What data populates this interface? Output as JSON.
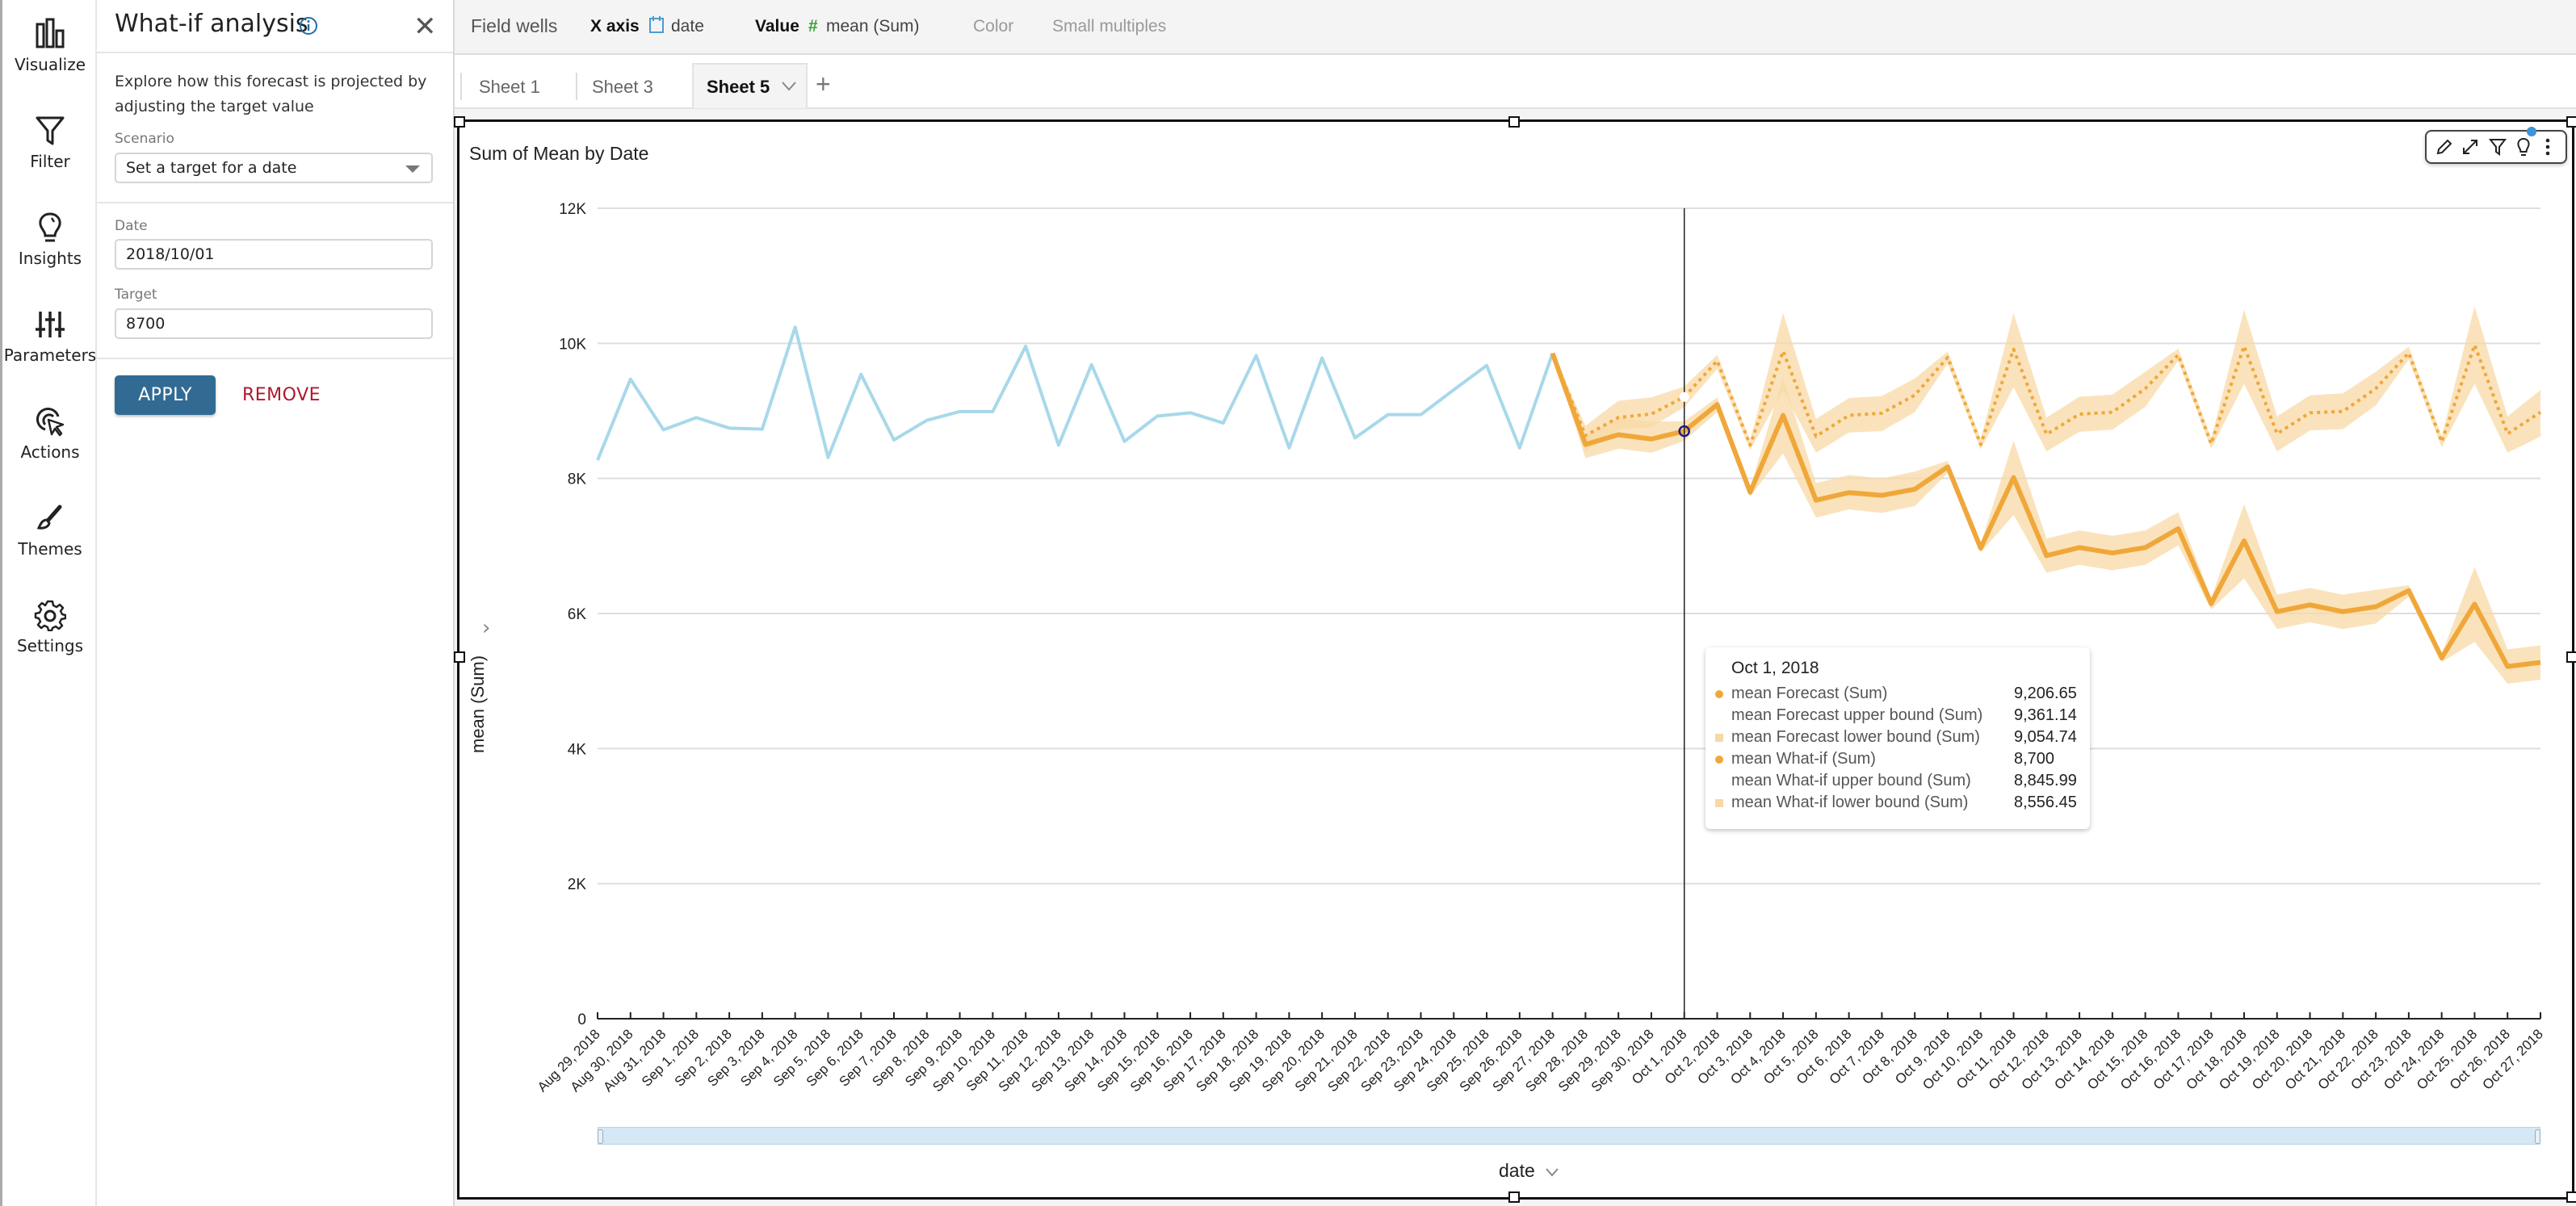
{
  "sidebar": {
    "items": [
      {
        "label": "Visualize",
        "icon": "bar-chart-icon"
      },
      {
        "label": "Filter",
        "icon": "filter-icon"
      },
      {
        "label": "Insights",
        "icon": "lightbulb-icon"
      },
      {
        "label": "Parameters",
        "icon": "sliders-icon"
      },
      {
        "label": "Actions",
        "icon": "cursor-target-icon"
      },
      {
        "label": "Themes",
        "icon": "brush-icon"
      },
      {
        "label": "Settings",
        "icon": "gear-icon"
      }
    ]
  },
  "panel": {
    "title": "What-if analysis",
    "description": "Explore how this forecast is projected by adjusting the target value",
    "scenario_label": "Scenario",
    "scenario_value": "Set a target for a date",
    "date_label": "Date",
    "date_value": "2018/10/01",
    "target_label": "Target",
    "target_value": "8700",
    "apply_label": "APPLY",
    "remove_label": "REMOVE"
  },
  "field_wells": {
    "title": "Field wells",
    "x_axis_label": "X axis",
    "x_axis_field": "date",
    "value_label": "Value",
    "value_field": "mean (Sum)",
    "color_label": "Color",
    "small_multiples_label": "Small multiples"
  },
  "tabs": [
    {
      "label": "Sheet 1",
      "active": false
    },
    {
      "label": "Sheet 3",
      "active": false
    },
    {
      "label": "Sheet 5",
      "active": true
    }
  ],
  "colors": {
    "actual": "#a8d8ea",
    "forecast": "#f0a73a",
    "band": "#f8d9a6",
    "apply": "#316b94",
    "remove": "#b0182c",
    "crosshair_point": "#1b1b8a"
  },
  "tooltip": {
    "date": "Oct 1, 2018",
    "rows": [
      {
        "label": "mean Forecast (Sum)",
        "value": "9,206.65",
        "marker": "dot"
      },
      {
        "label": "mean Forecast upper bound (Sum)",
        "value": "9,361.14",
        "marker": "none"
      },
      {
        "label": "mean Forecast lower bound (Sum)",
        "value": "9,054.74",
        "marker": "square"
      },
      {
        "label": "mean What-if (Sum)",
        "value": "8,700",
        "marker": "dot"
      },
      {
        "label": "mean What-if upper bound (Sum)",
        "value": "8,845.99",
        "marker": "none"
      },
      {
        "label": "mean What-if lower bound (Sum)",
        "value": "8,556.45",
        "marker": "square"
      }
    ]
  },
  "chart_data": {
    "type": "line",
    "title": "Sum of Mean by Date",
    "xlabel": "date",
    "ylabel": "mean (Sum)",
    "ylim": [
      0,
      12000
    ],
    "yticks": [
      0,
      2000,
      4000,
      6000,
      8000,
      10000,
      12000
    ],
    "ytick_labels": [
      "0",
      "2K",
      "4K",
      "6K",
      "8K",
      "10K",
      "12K"
    ],
    "grid": true,
    "legend": "none",
    "crosshair_category": "Oct 1, 2018",
    "categories": [
      "Aug 29, 2018",
      "Aug 30, 2018",
      "Aug 31, 2018",
      "Sep 1, 2018",
      "Sep 2, 2018",
      "Sep 3, 2018",
      "Sep 4, 2018",
      "Sep 5, 2018",
      "Sep 6, 2018",
      "Sep 7, 2018",
      "Sep 8, 2018",
      "Sep 9, 2018",
      "Sep 10, 2018",
      "Sep 11, 2018",
      "Sep 12, 2018",
      "Sep 13, 2018",
      "Sep 14, 2018",
      "Sep 15, 2018",
      "Sep 16, 2018",
      "Sep 17, 2018",
      "Sep 18, 2018",
      "Sep 19, 2018",
      "Sep 20, 2018",
      "Sep 21, 2018",
      "Sep 22, 2018",
      "Sep 23, 2018",
      "Sep 24, 2018",
      "Sep 25, 2018",
      "Sep 26, 2018",
      "Sep 27, 2018",
      "Sep 28, 2018",
      "Sep 29, 2018",
      "Sep 30, 2018",
      "Oct 1, 2018",
      "Oct 2, 2018",
      "Oct 3, 2018",
      "Oct 4, 2018",
      "Oct 5, 2018",
      "Oct 6, 2018",
      "Oct 7, 2018",
      "Oct 8, 2018",
      "Oct 9, 2018",
      "Oct 10, 2018",
      "Oct 11, 2018",
      "Oct 12, 2018",
      "Oct 13, 2018",
      "Oct 14, 2018",
      "Oct 15, 2018",
      "Oct 16, 2018",
      "Oct 17, 2018",
      "Oct 18, 2018",
      "Oct 19, 2018",
      "Oct 20, 2018",
      "Oct 21, 2018",
      "Oct 22, 2018",
      "Oct 23, 2018",
      "Oct 24, 2018",
      "Oct 25, 2018",
      "Oct 26, 2018",
      "Oct 27, 2018"
    ],
    "series": [
      {
        "name": "mean (Sum)",
        "style": "actual",
        "start_index": 0,
        "values": [
          8270,
          9470,
          8720,
          8900,
          8745,
          8730,
          10240,
          8310,
          9540,
          8570,
          8860,
          8990,
          8990,
          9956,
          8492,
          9684,
          8548,
          8924,
          8972,
          8820,
          9820,
          8452,
          9784,
          8600,
          8944,
          8944,
          9312,
          9672,
          8452,
          9852
        ]
      },
      {
        "name": "mean Forecast (Sum)",
        "style": "dotted",
        "start_index": 29,
        "values": [
          9852,
          8635,
          8902,
          8954,
          9206.65,
          9741,
          8495,
          9884,
          8623,
          8934,
          8966,
          9233,
          9792,
          8503,
          9912,
          8653,
          8952,
          8980,
          9331,
          9829,
          8514,
          9960,
          8661,
          8972,
          8992,
          9331,
          9857,
          8542,
          9976,
          8661,
          8980
        ]
      },
      {
        "name": "mean Forecast upper bound (Sum)",
        "start_index": 29,
        "values": [
          9852,
          8780,
          9150,
          9200,
          9361.14,
          9830,
          8560,
          10450,
          8880,
          9190,
          9220,
          9480,
          9880,
          8580,
          10450,
          8900,
          9210,
          9240,
          9580,
          9920,
          8590,
          10500,
          8920,
          9230,
          9260,
          9580,
          9950,
          8620,
          10550,
          8920,
          9310
        ]
      },
      {
        "name": "mean Forecast lower bound (Sum)",
        "start_index": 29,
        "values": [
          9852,
          8400,
          8720,
          8760,
          9054.74,
          9620,
          8420,
          9300,
          8380,
          8680,
          8700,
          8980,
          9700,
          8430,
          9350,
          8400,
          8690,
          8720,
          9060,
          9740,
          8440,
          9400,
          8400,
          8710,
          8730,
          9080,
          9760,
          8460,
          9400,
          8380,
          8620
        ]
      },
      {
        "name": "mean What-if (Sum)",
        "style": "solid",
        "start_index": 29,
        "values": [
          9852,
          8503,
          8647,
          8583,
          8700,
          9094,
          7796,
          8934,
          7677,
          7790,
          7750,
          7840,
          8171,
          6968,
          8012,
          6857,
          6976,
          6896,
          6976,
          7255,
          6147,
          7076,
          6028,
          6127,
          6028,
          6100,
          6339,
          5343,
          6139,
          5216,
          5275
        ]
      },
      {
        "name": "mean What-if upper bound (Sum)",
        "start_index": 29,
        "values": [
          9852,
          8640,
          8900,
          8840,
          8845.99,
          9200,
          7860,
          9500,
          7930,
          8050,
          8000,
          8100,
          8260,
          7030,
          8560,
          7110,
          7230,
          7150,
          7230,
          7500,
          6230,
          7620,
          6280,
          6380,
          6280,
          6350,
          6420,
          5400,
          6690,
          5470,
          5530
        ]
      },
      {
        "name": "mean What-if lower bound (Sum)",
        "start_index": 29,
        "values": [
          9852,
          8300,
          8440,
          8380,
          8556.45,
          8980,
          7730,
          8370,
          7420,
          7540,
          7490,
          7590,
          8080,
          6900,
          7460,
          6600,
          6720,
          6640,
          6720,
          7010,
          6060,
          6520,
          5770,
          5870,
          5770,
          5850,
          6250,
          5280,
          5580,
          4960,
          5020
        ]
      }
    ]
  }
}
